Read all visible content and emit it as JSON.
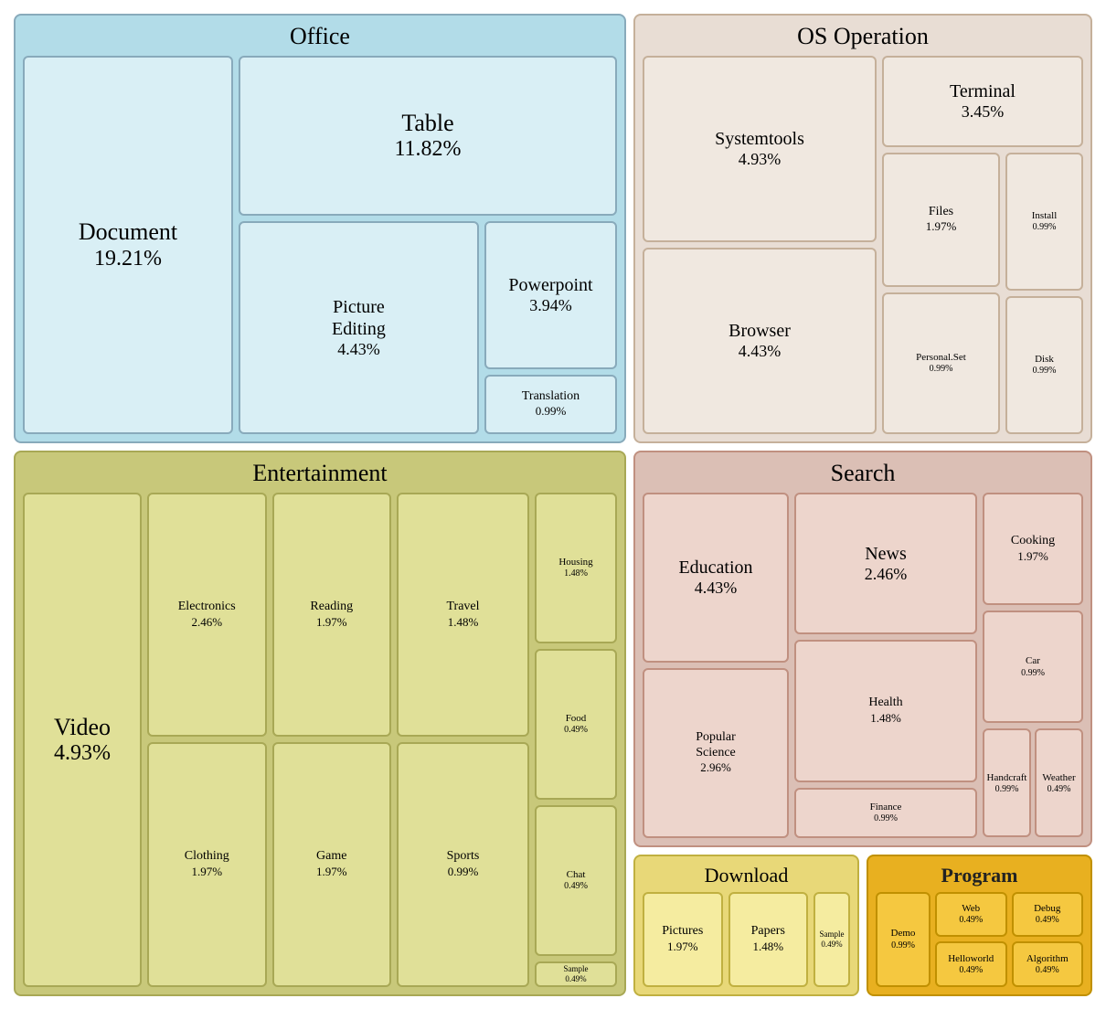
{
  "office": {
    "title": "Office",
    "document": {
      "label": "Document",
      "pct": "19.21%"
    },
    "table": {
      "label": "Table",
      "pct": "11.82%"
    },
    "picture_editing": {
      "label": "Picture\nEditing",
      "pct": "4.43%"
    },
    "powerpoint": {
      "label": "Powerpoint",
      "pct": "3.94%"
    },
    "translation": {
      "label": "Translation",
      "pct": "0.99%"
    }
  },
  "os": {
    "title": "OS Operation",
    "systemtools": {
      "label": "Systemtools",
      "pct": "4.93%"
    },
    "terminal": {
      "label": "Terminal",
      "pct": "3.45%"
    },
    "browser": {
      "label": "Browser",
      "pct": "4.43%"
    },
    "files": {
      "label": "Files",
      "pct": "1.97%"
    },
    "install": {
      "label": "Install",
      "pct": "0.99%"
    },
    "disk": {
      "label": "Disk",
      "pct": "0.99%"
    },
    "personalset": {
      "label": "Personal.Set",
      "pct": "0.99%"
    }
  },
  "entertainment": {
    "title": "Entertainment",
    "video": {
      "label": "Video",
      "pct": "4.93%"
    },
    "electronics": {
      "label": "Electronics",
      "pct": "2.46%"
    },
    "reading": {
      "label": "Reading",
      "pct": "1.97%"
    },
    "clothing": {
      "label": "Clothing",
      "pct": "1.97%"
    },
    "game": {
      "label": "Game",
      "pct": "1.97%"
    },
    "travel": {
      "label": "Travel",
      "pct": "1.48%"
    },
    "sports": {
      "label": "Sports",
      "pct": "0.99%"
    },
    "housing": {
      "label": "Housing",
      "pct": "1.48%"
    },
    "food": {
      "label": "Food",
      "pct": "0.49%"
    },
    "chat": {
      "label": "Chat",
      "pct": "0.49%"
    },
    "sample": {
      "label": "Sample",
      "pct": "0.49%"
    }
  },
  "search": {
    "title": "Search",
    "education": {
      "label": "Education",
      "pct": "4.43%"
    },
    "news": {
      "label": "News",
      "pct": "2.46%"
    },
    "cooking": {
      "label": "Cooking",
      "pct": "1.97%"
    },
    "popular_science": {
      "label": "Popular\nScience",
      "pct": "2.96%"
    },
    "health": {
      "label": "Health",
      "pct": "1.48%"
    },
    "car": {
      "label": "Car",
      "pct": "0.99%"
    },
    "finance": {
      "label": "Finance",
      "pct": "0.99%"
    },
    "handcraft": {
      "label": "Handcraft",
      "pct": "0.99%"
    },
    "weather": {
      "label": "Weather",
      "pct": "0.49%"
    }
  },
  "download": {
    "title": "Download",
    "pictures": {
      "label": "Pictures",
      "pct": "1.97%"
    },
    "papers": {
      "label": "Papers",
      "pct": "1.48%"
    },
    "sample": {
      "label": "Sample",
      "pct": "0.49%"
    }
  },
  "program": {
    "title": "Program",
    "demo": {
      "label": "Demo",
      "pct": "0.99%"
    },
    "web": {
      "label": "Web",
      "pct": "0.49%"
    },
    "debug": {
      "label": "Debug",
      "pct": "0.49%"
    },
    "helloworld": {
      "label": "Helloworld",
      "pct": "0.49%"
    },
    "algorithm": {
      "label": "Algorithm",
      "pct": "0.49%"
    }
  }
}
